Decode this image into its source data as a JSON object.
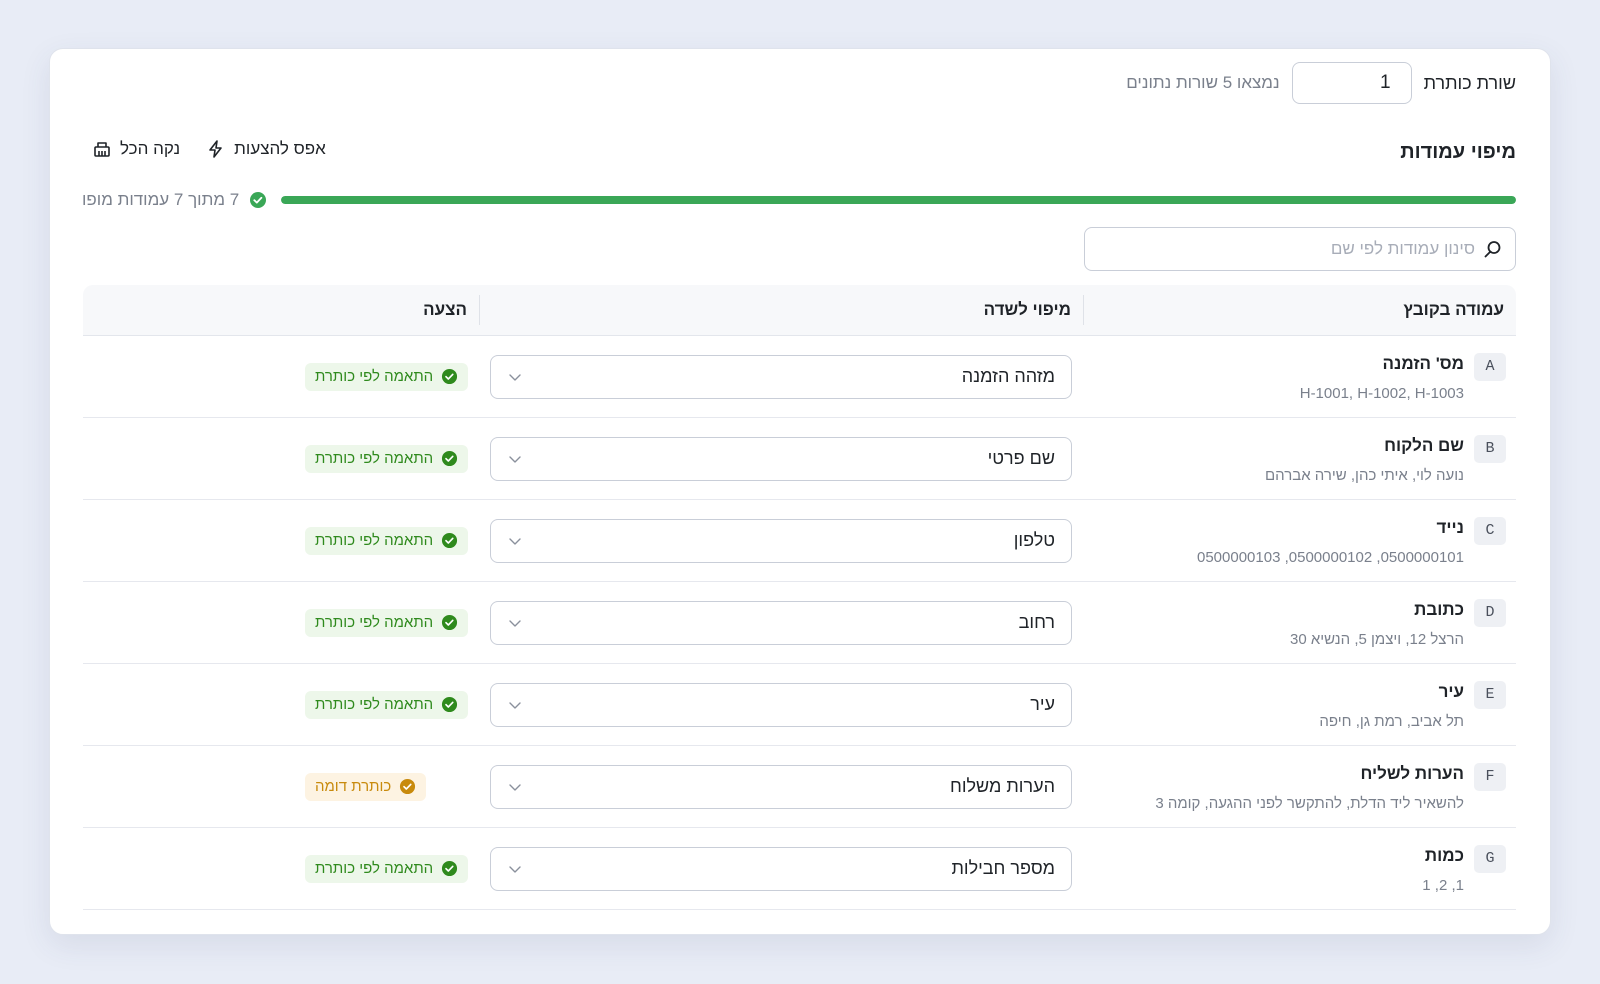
{
  "header": {
    "label": "שורת כותרת",
    "value": "1",
    "info": "נמצאו 5 שורות נתונים"
  },
  "mapping": {
    "title": "מיפוי עמודות",
    "reset_label": "אפס להצעות",
    "clear_label": "נקה הכל",
    "progress_text": "7 מתוך 7 עמודות מופו",
    "progress_fraction": 1.0,
    "search_placeholder": "סינון עמודות לפי שם"
  },
  "table": {
    "headers": {
      "file_column": "עמודה בקובץ",
      "field_mapping": "מיפוי לשדה",
      "suggestion": "הצעה"
    },
    "rows": [
      {
        "letter": "A",
        "name": "מס' הזמנה",
        "sample": "H-1001, H-1002, H-1003",
        "field": "מזהה הזמנה",
        "suggestion": "התאמה לפי כותרת",
        "status": "green"
      },
      {
        "letter": "B",
        "name": "שם הלקוח",
        "sample": "נועה לוי, איתי כהן, שירה אברהם",
        "field": "שם פרטי",
        "suggestion": "התאמה לפי כותרת",
        "status": "green"
      },
      {
        "letter": "C",
        "name": "נייד",
        "sample": "0500000101, 0500000102, 0500000103",
        "field": "טלפון",
        "suggestion": "התאמה לפי כותרת",
        "status": "green"
      },
      {
        "letter": "D",
        "name": "כתובת",
        "sample": "הרצל 12, ויצמן 5, הנשיא 30",
        "field": "רחוב",
        "suggestion": "התאמה לפי כותרת",
        "status": "green"
      },
      {
        "letter": "E",
        "name": "עיר",
        "sample": "תל אביב, רמת גן, חיפה",
        "field": "עיר",
        "suggestion": "התאמה לפי כותרת",
        "status": "green"
      },
      {
        "letter": "F",
        "name": "הערות לשליח",
        "sample": "להשאיר ליד הדלת, להתקשר לפני ההגעה, קומה 3",
        "field": "הערות משלוח",
        "suggestion": "כותרת דומה",
        "status": "amber"
      },
      {
        "letter": "G",
        "name": "כמות",
        "sample": "1, 2, 1",
        "field": "מספר חבילות",
        "suggestion": "התאמה לפי כותרת",
        "status": "green"
      }
    ]
  },
  "colors": {
    "accent_green": "#3aa757",
    "badge_green_text": "#2f8a1d",
    "badge_amber_text": "#c88a0c"
  }
}
